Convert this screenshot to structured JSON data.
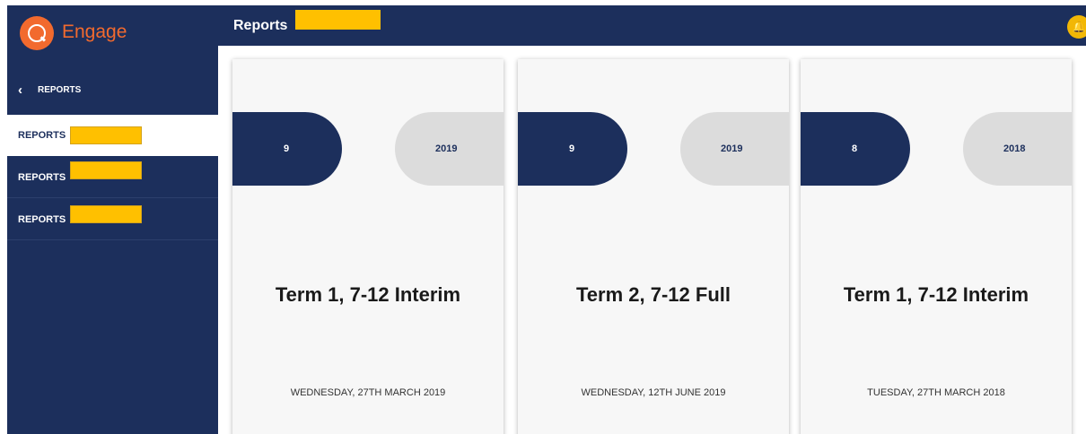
{
  "app": {
    "name": "Engage"
  },
  "sidebar": {
    "back_label": "REPORTS",
    "items": [
      {
        "label": "REPORTS",
        "active": true
      },
      {
        "label": "REPORTS",
        "active": false
      },
      {
        "label": "REPORTS",
        "active": false
      }
    ]
  },
  "header": {
    "title": "Reports"
  },
  "colors": {
    "navy": "#1c2f5c",
    "brand_orange": "#f26a2e",
    "redaction": "#ffc000",
    "pill_grey": "#dcdcdc"
  },
  "cards": [
    {
      "year_level": "9",
      "year": "2019",
      "title": "Term 1, 7-12 Interim",
      "date": "WEDNESDAY, 27TH MARCH 2019"
    },
    {
      "year_level": "9",
      "year": "2019",
      "title": "Term 2, 7-12 Full",
      "date": "WEDNESDAY, 12TH JUNE 2019"
    },
    {
      "year_level": "8",
      "year": "2018",
      "title": "Term 1, 7-12 Interim",
      "date": "TUESDAY, 27TH MARCH 2018"
    }
  ]
}
